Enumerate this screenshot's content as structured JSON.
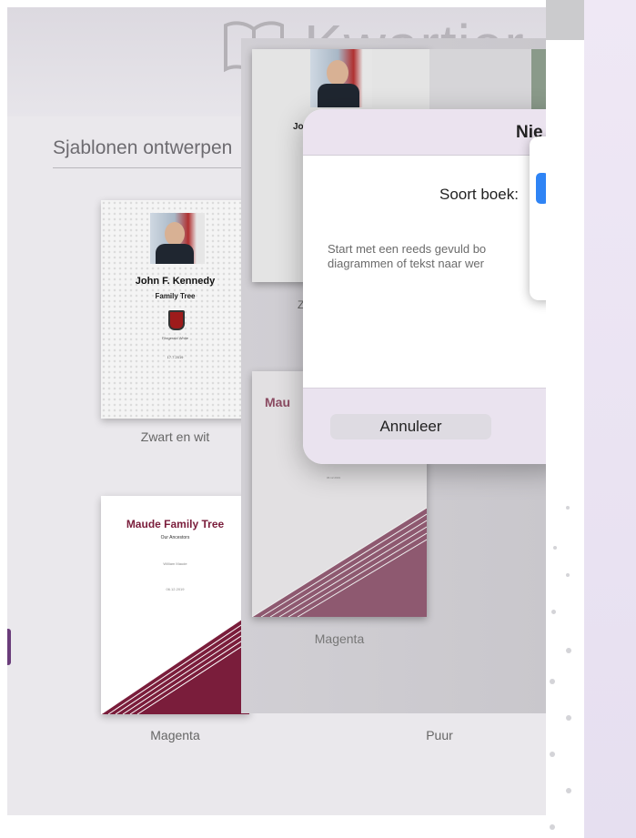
{
  "app": {
    "title": "Kwartier"
  },
  "gallery": {
    "section_title": "Sjablonen ontwerpen",
    "templates": [
      {
        "label": "Zwart en wit",
        "name": "John F. Kennedy",
        "subtitle": "Family Tree",
        "author": "Fitzgerald White",
        "date": "17.7.2019"
      },
      {
        "label": "Magenta",
        "name": "Maude Family Tree",
        "subtitle": "Our Ancestors",
        "author": "William Maude",
        "date": "06.12.2019"
      },
      {
        "label": "Puur"
      }
    ]
  },
  "switcher": {
    "thumb1_partial": "Jo",
    "thumb1_label_partial": "Z",
    "thumb2_partial": "Mau",
    "thumb2_date": "06.12.2019",
    "thumb2_label": "Magenta"
  },
  "dialog": {
    "title": "Nie",
    "book_type_label": "Soort boek:",
    "description_line1": "Start met een reeds gevuld bo",
    "description_line2": "diagrammen of tekst naar wer",
    "cancel_label": "Annuleer"
  },
  "colors": {
    "accent": "#2f84f5",
    "magenta": "#7a1d3b",
    "lavender": "#ebe3ef"
  }
}
